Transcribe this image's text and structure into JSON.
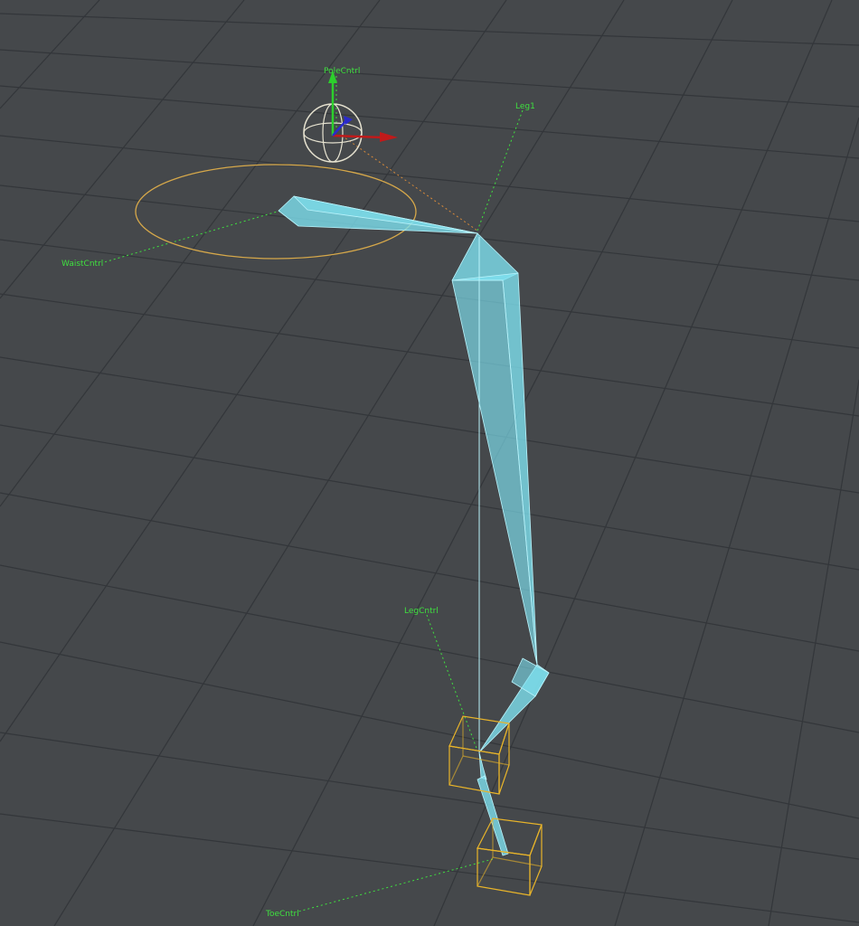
{
  "viewport": {
    "background": "#45484b",
    "grid_color": "#33363a",
    "bone_fill": "#7fe3f2",
    "bone_edge": "#b9f3fb",
    "control_ring": "#d6a84a",
    "control_box": "#e8b42a",
    "label_color": "#3fe03f"
  },
  "labels": {
    "pole": "PoleCntrl",
    "leg": "Leg1",
    "waist": "WaistCntrl",
    "leg_ctrl": "LegCntrl",
    "toe": "ToeCntrl"
  },
  "gizmo": {
    "axis_y": "#2ccf2c",
    "axis_x": "#c01a1a",
    "axis_z": "#2a2acc",
    "sphere": "#e6e2d0"
  }
}
